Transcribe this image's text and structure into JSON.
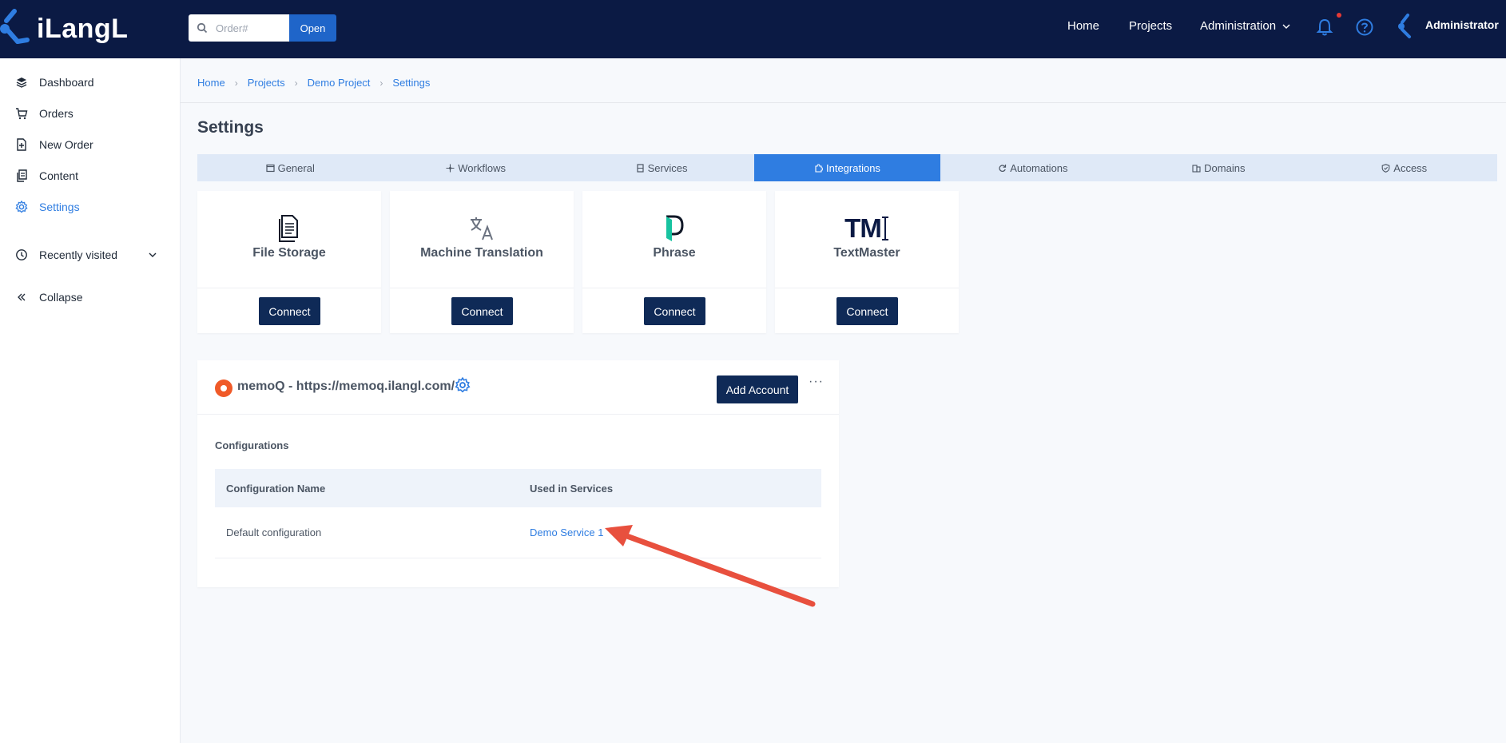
{
  "app": {
    "logo_text": "iLangL"
  },
  "search": {
    "placeholder": "Order#",
    "value": "",
    "button_label": "Open"
  },
  "topnav": {
    "items": [
      "Home",
      "Projects",
      "Administration"
    ],
    "user_name": "Administrator",
    "icons": [
      "bell-icon",
      "help-icon",
      "user-icon"
    ]
  },
  "sidebar": {
    "items": [
      {
        "label": "Dashboard",
        "icon": "layers-icon"
      },
      {
        "label": "Orders",
        "icon": "cart-icon"
      },
      {
        "label": "New Order",
        "icon": "new-doc-icon"
      },
      {
        "label": "Content",
        "icon": "content-icon"
      },
      {
        "label": "Settings",
        "icon": "gear-icon",
        "active": true
      },
      {
        "label": "Recently visited",
        "icon": "history-icon"
      },
      {
        "label": "Collapse",
        "icon": "double-chevron-left-icon"
      }
    ]
  },
  "breadcrumb": [
    "Home",
    "Projects",
    "Demo Project",
    "Settings"
  ],
  "page": {
    "title": "Settings"
  },
  "tabs": [
    {
      "label": "General"
    },
    {
      "label": "Workflows"
    },
    {
      "label": "Services"
    },
    {
      "label": "Integrations",
      "active": true
    },
    {
      "label": "Automations"
    },
    {
      "label": "Domains"
    },
    {
      "label": "Access"
    }
  ],
  "cards": [
    {
      "title": "File Storage",
      "button": "Connect",
      "icon": "file-storage-icon"
    },
    {
      "title": "Machine Translation",
      "button": "Connect",
      "icon": "translate-icon"
    },
    {
      "title": "Phrase",
      "button": "Connect",
      "icon": "phrase-logo-icon"
    },
    {
      "title": "TextMaster",
      "button": "Connect",
      "icon": "textmaster-logo-icon",
      "logo_text": "TM"
    }
  ],
  "panel": {
    "title": "memoQ - https://memoq.ilangl.com/",
    "add_account": "Add Account",
    "more": "···",
    "configurations_label": "Configurations",
    "columns": [
      "Configuration Name",
      "Used in Services"
    ],
    "rows": [
      {
        "name": "Default configuration",
        "service": "Demo Service 1"
      }
    ]
  },
  "colors": {
    "topbar": "#0b1a44",
    "accent": "#2f7de1",
    "button": "#0f2a57",
    "annotation_arrow": "#e8503e"
  }
}
